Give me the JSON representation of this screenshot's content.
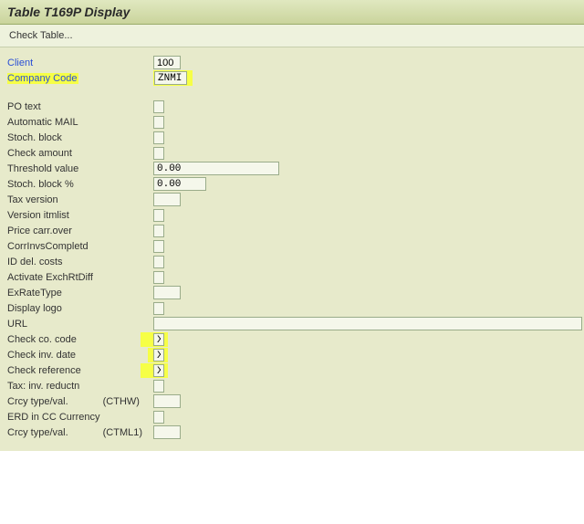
{
  "header": {
    "title": "Table T169P Display"
  },
  "toolbar": {
    "check_table": "Check Table..."
  },
  "top": {
    "client_label": "Client",
    "client_value": "100",
    "ccode_label": "Company Code",
    "ccode_value": "ZNMI"
  },
  "rows": {
    "po_text": "PO text",
    "auto_mail": "Automatic MAIL",
    "stoch_block": "Stoch. block",
    "check_amount": "Check amount",
    "threshold_label": "Threshold value",
    "threshold_value": "0.00",
    "stoch_block_pct_label": "Stoch. block  %",
    "stoch_block_pct_value": "0.00",
    "tax_version": "Tax version",
    "version_itmlist": "Version itmlist",
    "price_carr_over": "Price carr.over",
    "corrinvs": "CorrInvsCompletd",
    "id_del_costs": "ID del. costs",
    "activate_exch": "Activate ExchRtDiff",
    "exratetype": "ExRateType",
    "display_logo": "Display logo",
    "url": "URL",
    "check_co_code_label": "Check co. code",
    "check_co_code_value": "X",
    "check_inv_date_label": "Check inv. date",
    "check_inv_date_value": "X",
    "check_reference_label": "Check reference",
    "check_reference_value": "X",
    "tax_inv_reductn": "Tax: inv. reductn",
    "crcy_type1_label": "Crcy type/val.",
    "crcy_type1_sub": "(CTHW)",
    "erd_cc": "ERD in CC Currency",
    "crcy_type2_label": "Crcy type/val.",
    "crcy_type2_sub": "(CTML1)"
  }
}
